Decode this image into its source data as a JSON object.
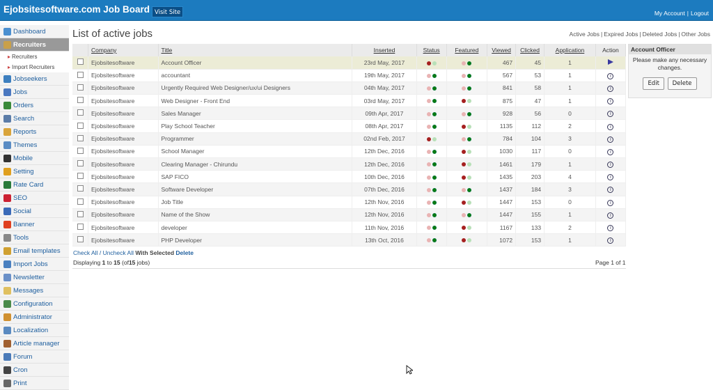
{
  "header": {
    "brand": "Ejobsitesoftware.com Job Board",
    "visit_site": "Visit Site",
    "my_account": "My Account",
    "separator": "|",
    "logout": "Logout"
  },
  "sidebar": {
    "items": [
      {
        "label": "Dashboard",
        "icon": "home-icon",
        "color": "#4a8fd0"
      },
      {
        "label": "Recruiters",
        "icon": "recruiter-icon",
        "color": "#c9a04a",
        "active": true
      },
      {
        "label": "Jobseekers",
        "icon": "jobseeker-icon",
        "color": "#3d7fbf"
      },
      {
        "label": "Jobs",
        "icon": "jobs-icon",
        "color": "#4a78c0"
      },
      {
        "label": "Orders",
        "icon": "orders-icon",
        "color": "#3a8a3a"
      },
      {
        "label": "Search",
        "icon": "search-icon",
        "color": "#5b7ca8"
      },
      {
        "label": "Reports",
        "icon": "reports-icon",
        "color": "#d9a43b"
      },
      {
        "label": "Themes",
        "icon": "themes-icon",
        "color": "#5a8cc4"
      },
      {
        "label": "Mobile",
        "icon": "mobile-icon",
        "color": "#333"
      },
      {
        "label": "Setting",
        "icon": "setting-icon",
        "color": "#e0a020"
      },
      {
        "label": "Rate Card",
        "icon": "rate-card-icon",
        "color": "#2a7a3a"
      },
      {
        "label": "SEO",
        "icon": "seo-icon",
        "color": "#c23"
      },
      {
        "label": "Social",
        "icon": "social-icon",
        "color": "#3a6ab8"
      },
      {
        "label": "Banner",
        "icon": "banner-icon",
        "color": "#e04020"
      },
      {
        "label": "Tools",
        "icon": "tools-icon",
        "color": "#888"
      },
      {
        "label": "Email templates",
        "icon": "email-templates-icon",
        "color": "#d0a030"
      },
      {
        "label": "Import Jobs",
        "icon": "import-jobs-icon",
        "color": "#4a80c0"
      },
      {
        "label": "Newsletter",
        "icon": "newsletter-icon",
        "color": "#6a90c8"
      },
      {
        "label": "Messages",
        "icon": "messages-icon",
        "color": "#e0c060"
      },
      {
        "label": "Configuration",
        "icon": "configuration-icon",
        "color": "#4a8a4a"
      },
      {
        "label": "Administrator",
        "icon": "administrator-icon",
        "color": "#d09030"
      },
      {
        "label": "Localization",
        "icon": "localization-icon",
        "color": "#5a8ac0"
      },
      {
        "label": "Article manager",
        "icon": "article-manager-icon",
        "color": "#a06030"
      },
      {
        "label": "Forum",
        "icon": "forum-icon",
        "color": "#4a7ab8"
      },
      {
        "label": "Cron",
        "icon": "cron-icon",
        "color": "#444"
      },
      {
        "label": "Print",
        "icon": "print-icon",
        "color": "#666"
      }
    ],
    "sub_items": [
      "Recruiters",
      "Import Recruiters"
    ]
  },
  "main": {
    "title": "List of active jobs",
    "links": [
      "Active Jobs",
      "Expired Jobs",
      "Deleted Jobs",
      "Other Jobs"
    ],
    "link_sep": "|",
    "columns": [
      "Company",
      "Title",
      "Inserted",
      "Status",
      "Featured",
      "Viewed",
      "Clicked",
      "Application",
      "Action"
    ],
    "rows": [
      {
        "company": "Ejobsitesoftware",
        "title": "Account Officer",
        "inserted": "23rd May, 2017",
        "status": "red",
        "featured": "green",
        "viewed": "467",
        "clicked": "45",
        "application": "1",
        "action": "play"
      },
      {
        "company": "Ejobsitesoftware",
        "title": "accountant",
        "inserted": "19th May, 2017",
        "status": "green",
        "featured": "green",
        "viewed": "567",
        "clicked": "53",
        "application": "1",
        "action": "info"
      },
      {
        "company": "Ejobsitesoftware",
        "title": "Urgently Required Web Designer/ux/ui Designers",
        "inserted": "04th May, 2017",
        "status": "green",
        "featured": "green",
        "viewed": "841",
        "clicked": "58",
        "application": "1",
        "action": "info"
      },
      {
        "company": "Ejobsitesoftware",
        "title": "Web Designer - Front End",
        "inserted": "03rd May, 2017",
        "status": "green",
        "featured": "red",
        "viewed": "875",
        "clicked": "47",
        "application": "1",
        "action": "info"
      },
      {
        "company": "Ejobsitesoftware",
        "title": "Sales Manager",
        "inserted": "09th Apr, 2017",
        "status": "green",
        "featured": "green",
        "viewed": "928",
        "clicked": "56",
        "application": "0",
        "action": "info"
      },
      {
        "company": "Ejobsitesoftware",
        "title": "Play School Teacher",
        "inserted": "08th Apr, 2017",
        "status": "green",
        "featured": "red",
        "viewed": "1135",
        "clicked": "112",
        "application": "2",
        "action": "info"
      },
      {
        "company": "Ejobsitesoftware",
        "title": "Programmer",
        "inserted": "02nd Feb, 2017",
        "status": "red",
        "featured": "green",
        "viewed": "784",
        "clicked": "104",
        "application": "3",
        "action": "info"
      },
      {
        "company": "Ejobsitesoftware",
        "title": "School Manager",
        "inserted": "12th Dec, 2016",
        "status": "green",
        "featured": "red",
        "viewed": "1030",
        "clicked": "117",
        "application": "0",
        "action": "info"
      },
      {
        "company": "Ejobsitesoftware",
        "title": "Clearing Manager - Chirundu",
        "inserted": "12th Dec, 2016",
        "status": "green",
        "featured": "red",
        "viewed": "1461",
        "clicked": "179",
        "application": "1",
        "action": "info"
      },
      {
        "company": "Ejobsitesoftware",
        "title": "SAP FICO",
        "inserted": "10th Dec, 2016",
        "status": "green",
        "featured": "red",
        "viewed": "1435",
        "clicked": "203",
        "application": "4",
        "action": "info"
      },
      {
        "company": "Ejobsitesoftware",
        "title": "Software Developer",
        "inserted": "07th Dec, 2016",
        "status": "green",
        "featured": "green",
        "viewed": "1437",
        "clicked": "184",
        "application": "3",
        "action": "info"
      },
      {
        "company": "Ejobsitesoftware",
        "title": "Job Title",
        "inserted": "12th Nov, 2016",
        "status": "green",
        "featured": "red",
        "viewed": "1447",
        "clicked": "153",
        "application": "0",
        "action": "info"
      },
      {
        "company": "Ejobsitesoftware",
        "title": "Name of the Show",
        "inserted": "12th Nov, 2016",
        "status": "green",
        "featured": "green",
        "viewed": "1447",
        "clicked": "155",
        "application": "1",
        "action": "info"
      },
      {
        "company": "Ejobsitesoftware",
        "title": "developer",
        "inserted": "11th Nov, 2016",
        "status": "green",
        "featured": "red",
        "viewed": "1167",
        "clicked": "133",
        "application": "2",
        "action": "info"
      },
      {
        "company": "Ejobsitesoftware",
        "title": "PHP Developer",
        "inserted": "13th Oct, 2016",
        "status": "green",
        "featured": "red",
        "viewed": "1072",
        "clicked": "153",
        "application": "1",
        "action": "info"
      }
    ],
    "check_all": "Check All",
    "slash": "/",
    "uncheck_all": "Uncheck All",
    "with_selected": "With Selected",
    "delete_label": "Delete",
    "displaying": "Displaying",
    "disp_from": "1",
    "disp_to_word": "to",
    "disp_to": "15",
    "disp_of_open": "(of",
    "disp_total": "15",
    "disp_jobs": "jobs)",
    "page_info": "Page 1 of 1"
  },
  "panel": {
    "title": "Account Officer",
    "message": "Please make any necessary changes.",
    "edit": "Edit",
    "delete": "Delete"
  }
}
